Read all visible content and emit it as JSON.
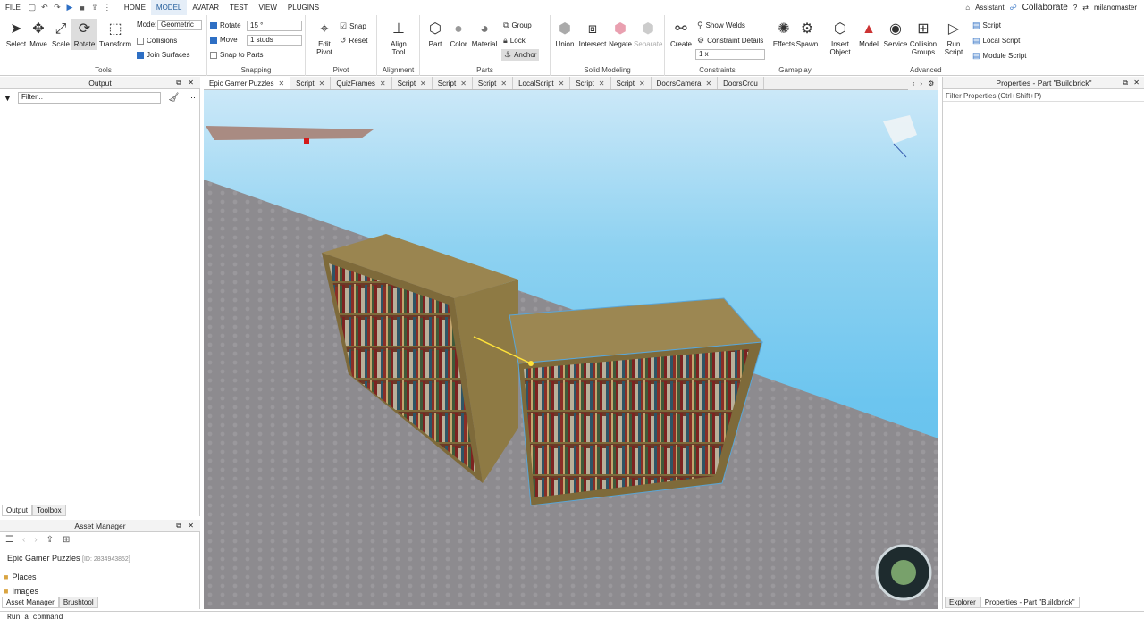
{
  "menu": {
    "file": "FILE",
    "items": [
      "HOME",
      "MODEL",
      "AVATAR",
      "TEST",
      "VIEW",
      "PLUGINS"
    ],
    "active": "MODEL",
    "assistant": "Assistant",
    "collaborate": "Collaborate",
    "username": "milanomaster"
  },
  "ribbon": {
    "tools": {
      "label": "Tools",
      "select": "Select",
      "move": "Move",
      "scale": "Scale",
      "rotate": "Rotate",
      "transform": "Transform"
    },
    "mode": {
      "label": "Mode:",
      "value": "Geometric",
      "collisions": "Collisions",
      "join_surfaces": "Join Surfaces"
    },
    "snapping": {
      "label": "Snapping",
      "rotate": "Rotate",
      "rotate_value": "15 °",
      "move": "Move",
      "move_value": "1 studs",
      "snap_to_parts": "Snap to Parts"
    },
    "pivot": {
      "label": "Pivot",
      "edit_pivot_1": "Edit",
      "edit_pivot_2": "Pivot",
      "snap": "Snap",
      "reset": "Reset"
    },
    "alignment": {
      "label": "Alignment",
      "align_1": "Align",
      "align_2": "Tool"
    },
    "parts": {
      "label": "Parts",
      "part": "Part",
      "color": "Color",
      "material": "Material",
      "group": "Group",
      "lock": "Lock",
      "anchor": "Anchor"
    },
    "solid": {
      "label": "Solid Modeling",
      "union": "Union",
      "intersect": "Intersect",
      "negate": "Negate",
      "separate": "Separate"
    },
    "constraints": {
      "label": "Constraints",
      "create": "Create",
      "show_welds": "Show Welds",
      "constraint_details": "Constraint Details",
      "scale_value": "1 x"
    },
    "gameplay": {
      "label": "Gameplay",
      "effects": "Effects",
      "spawn": "Spawn"
    },
    "advanced": {
      "label": "Advanced",
      "insert_1": "Insert",
      "insert_2": "Object",
      "model": "Model",
      "service": "Service",
      "collision_1": "Collision",
      "collision_2": "Groups",
      "run_1": "Run",
      "run_2": "Script",
      "script": "Script",
      "local_script": "Local Script",
      "module_script": "Module Script"
    }
  },
  "output": {
    "title": "Output",
    "filter_placeholder": "Filter...",
    "tab_output": "Output",
    "tab_toolbox": "Toolbox"
  },
  "asset_manager": {
    "title": "Asset Manager",
    "game_name": "Epic Gamer Puzzles",
    "game_id": "[ID: 2834943852]",
    "places": "Places",
    "images": "Images",
    "tab_asset": "Asset Manager",
    "tab_brush": "Brushtool"
  },
  "tabs": [
    "Epic Gamer Puzzles",
    "Script",
    "QuizFrames",
    "Script",
    "Script",
    "Script",
    "LocalScript",
    "Script",
    "Script",
    "DoorsCamera",
    "DoorsCrou"
  ],
  "properties": {
    "title": "Properties - Part \"Buildbrick\"",
    "filter": "Filter Properties (Ctrl+Shift+P)",
    "tab_explorer": "Explorer",
    "tab_properties": "Properties - Part \"Buildbrick\""
  },
  "command": {
    "placeholder": "Run a command"
  },
  "colors": {
    "accent": "#2e6fc4",
    "sky": "#6cc5ef",
    "baseplate": "#8d8b8f",
    "wood": "#8e7a44"
  }
}
